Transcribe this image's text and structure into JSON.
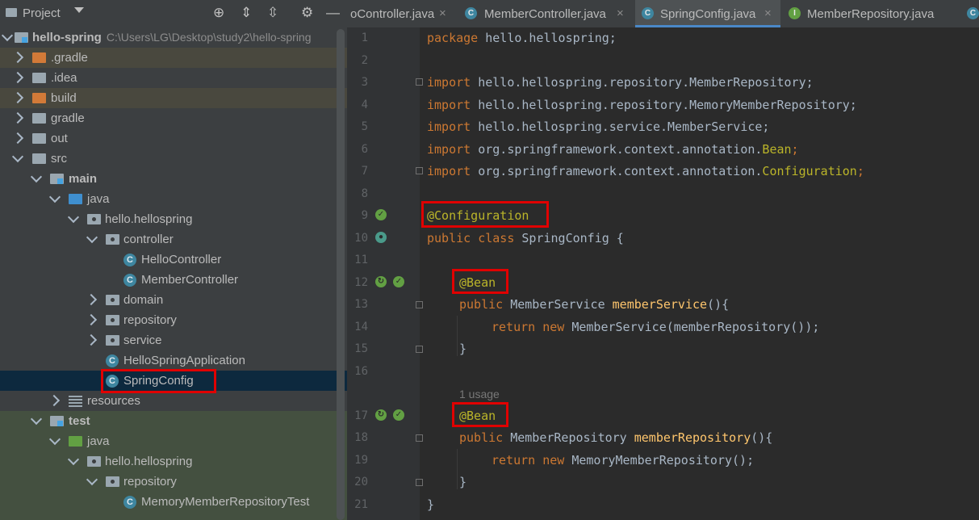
{
  "project_panel": {
    "title": "Project",
    "tree": [
      {
        "label": "hello-spring",
        "path": "C:\\Users\\LG\\Desktop\\study2\\hello-spring"
      },
      {
        "label": ".gradle"
      },
      {
        "label": ".idea"
      },
      {
        "label": "build"
      },
      {
        "label": "gradle"
      },
      {
        "label": "out"
      },
      {
        "label": "src"
      },
      {
        "label": "main"
      },
      {
        "label": "java"
      },
      {
        "label": "hello.hellospring"
      },
      {
        "label": "controller"
      },
      {
        "label": "HelloController"
      },
      {
        "label": "MemberController"
      },
      {
        "label": "domain"
      },
      {
        "label": "repository"
      },
      {
        "label": "service"
      },
      {
        "label": "HelloSpringApplication"
      },
      {
        "label": "SpringConfig"
      },
      {
        "label": "resources"
      },
      {
        "label": "test"
      },
      {
        "label": "java"
      },
      {
        "label": "hello.hellospring"
      },
      {
        "label": "repository"
      },
      {
        "label": "MemoryMemberRepositoryTest"
      }
    ]
  },
  "tabs": [
    {
      "label": "oController.java"
    },
    {
      "label": "MemberController.java"
    },
    {
      "label": "SpringConfig.java"
    },
    {
      "label": "MemberRepository.java"
    }
  ],
  "editor": {
    "usage_hint": "1 usage",
    "line_numbers": [
      "1",
      "2",
      "3",
      "4",
      "5",
      "6",
      "7",
      "8",
      "9",
      "10",
      "11",
      "12",
      "13",
      "14",
      "15",
      "16",
      "17",
      "18",
      "19",
      "20",
      "21"
    ],
    "code": {
      "l1": [
        "package",
        " hello.hellospring;"
      ],
      "l3": [
        "import",
        " hello.hellospring.repository.MemberRepository;"
      ],
      "l4": [
        "import",
        " hello.hellospring.repository.MemoryMemberRepository;"
      ],
      "l5": [
        "import",
        " hello.hellospring.service.MemberService;"
      ],
      "l6": [
        "import",
        " org.springframework.context.annotation.",
        "Bean",
        ";"
      ],
      "l7": [
        "import",
        " org.springframework.context.annotation.",
        "Configuration",
        ";"
      ],
      "l9": [
        "@Configuration"
      ],
      "l10": [
        "public class",
        " SpringConfig {"
      ],
      "l12": [
        "@Bean"
      ],
      "l13": [
        "public",
        " MemberService ",
        "memberService",
        "(){"
      ],
      "l14": [
        "return new",
        " MemberService(memberRepository());"
      ],
      "l15": [
        "}"
      ],
      "l17": [
        "@Bean"
      ],
      "l18": [
        "public",
        " MemberRepository ",
        "memberRepository",
        "(){"
      ],
      "l19": [
        "return new",
        " MemoryMemberRepository();"
      ],
      "l20": [
        "}"
      ],
      "l21": [
        "}"
      ]
    }
  },
  "colors": {
    "keyword": "#cc7832",
    "annotation": "#bbb529",
    "method": "#ffc66d",
    "highlight_box": "#e00000"
  }
}
